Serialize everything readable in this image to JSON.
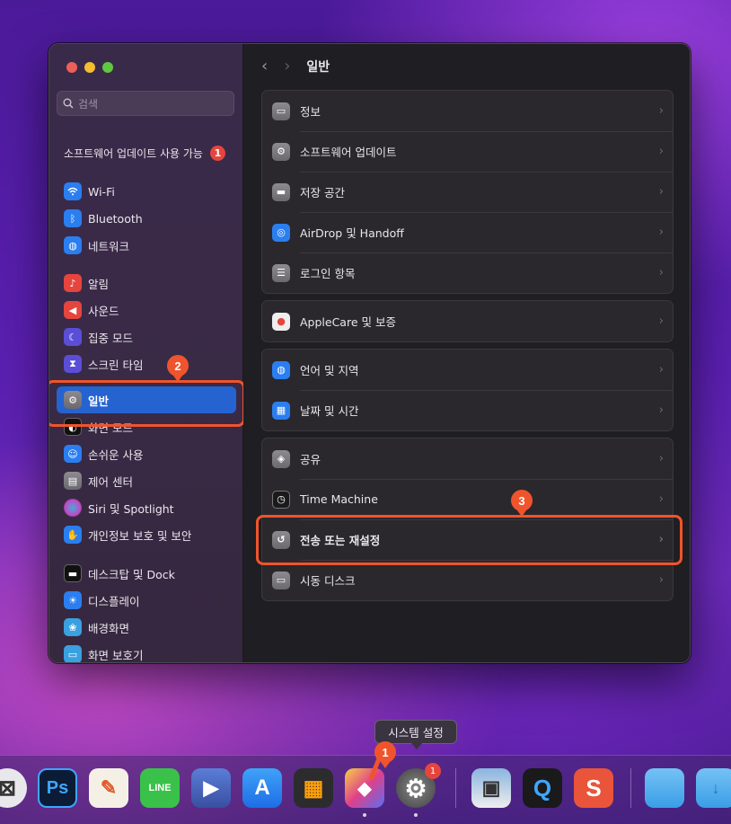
{
  "window": {
    "traffic_lights": [
      "close",
      "minimize",
      "zoom"
    ],
    "search": {
      "placeholder": "검색"
    },
    "update_notice": {
      "label": "소프트웨어 업데이트 사용 가능",
      "badge": "1"
    }
  },
  "sidebar": {
    "items": [
      {
        "label": "Wi-Fi",
        "icon": "wifi-icon",
        "color": "#2a7ef0"
      },
      {
        "label": "Bluetooth",
        "icon": "bluetooth-icon",
        "color": "#2a7ef0"
      },
      {
        "label": "네트워크",
        "icon": "globe-icon",
        "color": "#2a7ef0"
      },
      {
        "label": "알림",
        "icon": "bell-icon",
        "color": "#e5453d"
      },
      {
        "label": "사운드",
        "icon": "speaker-icon",
        "color": "#e5453d"
      },
      {
        "label": "집중 모드",
        "icon": "moon-icon",
        "color": "#5b4ed6"
      },
      {
        "label": "스크린 타임",
        "icon": "hourglass-icon",
        "color": "#5b4ed6"
      },
      {
        "label": "일반",
        "icon": "gear-icon",
        "color": "#8d8b90",
        "selected": true
      },
      {
        "label": "화면 모드",
        "icon": "appearance-icon",
        "color": "#1a1a1a"
      },
      {
        "label": "손쉬운 사용",
        "icon": "accessibility-icon",
        "color": "#2a7ef0"
      },
      {
        "label": "제어 센터",
        "icon": "control-center-icon",
        "color": "#8d8b90"
      },
      {
        "label": "Siri 및 Spotlight",
        "icon": "siri-icon",
        "color": "#c24ac6"
      },
      {
        "label": "개인정보 보호 및 보안",
        "icon": "hand-icon",
        "color": "#2a7ef0"
      },
      {
        "label": "데스크탑 및 Dock",
        "icon": "dock-icon",
        "color": "#1a1a1a"
      },
      {
        "label": "디스플레이",
        "icon": "sun-icon",
        "color": "#2a7ef0"
      },
      {
        "label": "배경화면",
        "icon": "flower-icon",
        "color": "#3aa0e0"
      },
      {
        "label": "화면 보호기",
        "icon": "screensaver-icon",
        "color": "#3aa0e0"
      }
    ]
  },
  "main": {
    "back": "‹",
    "forward": "›",
    "title": "일반",
    "groups": [
      {
        "rows": [
          {
            "label": "정보",
            "icon": "laptop-icon"
          },
          {
            "label": "소프트웨어 업데이트",
            "icon": "gear-badge-icon"
          },
          {
            "label": "저장 공간",
            "icon": "drive-icon"
          },
          {
            "label": "AirDrop 및 Handoff",
            "icon": "airdrop-icon"
          },
          {
            "label": "로그인 항목",
            "icon": "list-icon"
          }
        ]
      },
      {
        "rows": [
          {
            "label": "AppleCare 및 보증",
            "icon": "apple-icon"
          }
        ]
      },
      {
        "rows": [
          {
            "label": "언어 및 지역",
            "icon": "globe-icon"
          },
          {
            "label": "날짜 및 시간",
            "icon": "calendar-clock-icon"
          }
        ]
      },
      {
        "rows": [
          {
            "label": "공유",
            "icon": "share-icon"
          },
          {
            "label": "Time Machine",
            "icon": "time-machine-icon"
          },
          {
            "label": "전송 또는 재설정",
            "icon": "reset-icon",
            "highlight": true
          },
          {
            "label": "시동 디스크",
            "icon": "startup-disk-icon"
          }
        ]
      }
    ]
  },
  "annotations": {
    "step1": "1",
    "step2": "2",
    "step3": "3"
  },
  "dock": {
    "tooltip": "시스템 설정",
    "settings_badge": "1",
    "apps": [
      {
        "name": "cross-app-icon",
        "glyph": "⊠"
      },
      {
        "name": "photoshop-icon",
        "glyph": "Ps"
      },
      {
        "name": "sketch-pen-icon",
        "glyph": "✎"
      },
      {
        "name": "line-icon",
        "glyph": "LINE"
      },
      {
        "name": "player-icon",
        "glyph": "▶"
      },
      {
        "name": "app-store-icon",
        "glyph": "A"
      },
      {
        "name": "calculator-icon",
        "glyph": "▦"
      },
      {
        "name": "pixelmator-icon",
        "glyph": "◆"
      },
      {
        "name": "system-settings-icon",
        "glyph": "⚙"
      },
      {
        "name": "preview-icon",
        "glyph": "▣"
      },
      {
        "name": "quicktime-icon",
        "glyph": "Q"
      },
      {
        "name": "s-app-icon",
        "glyph": "S"
      },
      {
        "name": "folder-icon",
        "glyph": ""
      },
      {
        "name": "downloads-folder-icon",
        "glyph": "↓"
      }
    ]
  }
}
